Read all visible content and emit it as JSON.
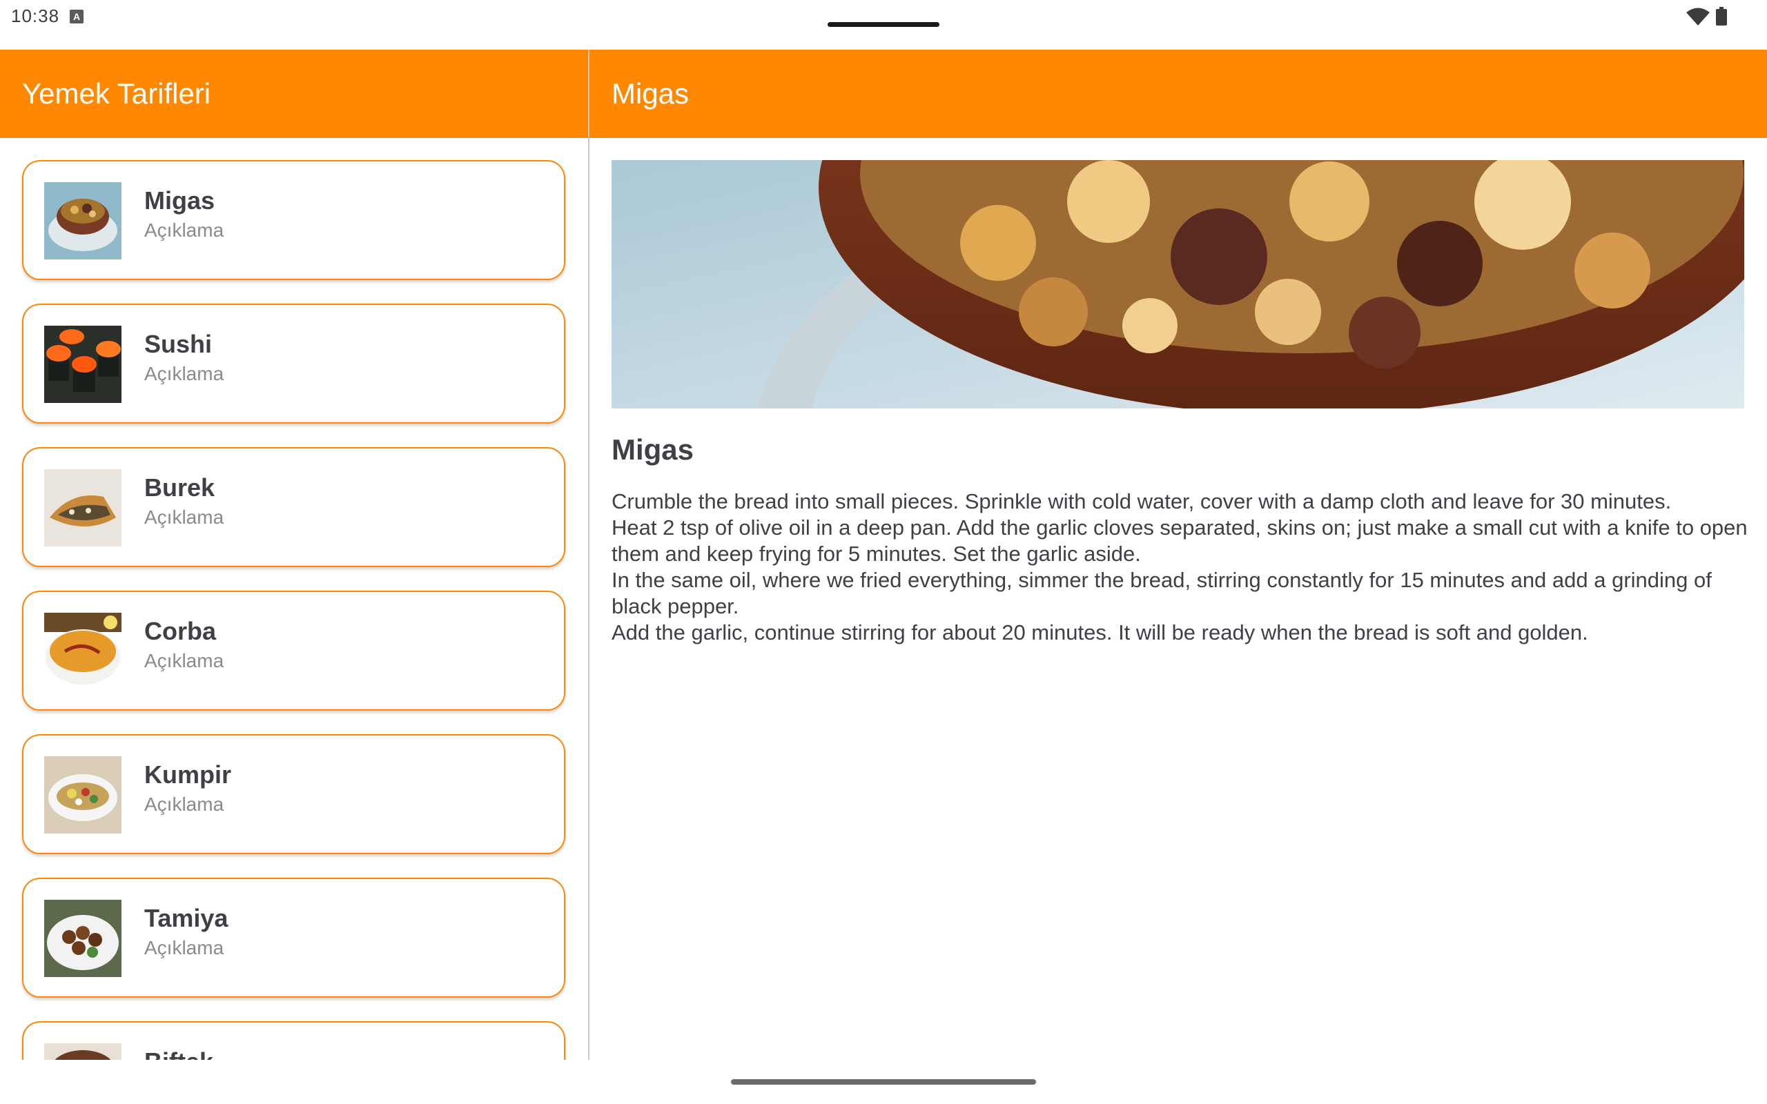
{
  "status_bar": {
    "time": "10:38",
    "indicator": "A",
    "icons": [
      "wifi-icon",
      "battery-icon"
    ]
  },
  "list_header": {
    "title": "Yemek Tarifleri"
  },
  "recipes": [
    {
      "title": "Migas",
      "subtitle": "Açıklama",
      "thumbnail": "migas-thumbnail"
    },
    {
      "title": "Sushi",
      "subtitle": "Açıklama",
      "thumbnail": "sushi-thumbnail"
    },
    {
      "title": "Burek",
      "subtitle": "Açıklama",
      "thumbnail": "burek-thumbnail"
    },
    {
      "title": "Corba",
      "subtitle": "Açıklama",
      "thumbnail": "corba-thumbnail"
    },
    {
      "title": "Kumpir",
      "subtitle": "Açıklama",
      "thumbnail": "kumpir-thumbnail"
    },
    {
      "title": "Tamiya",
      "subtitle": "Açıklama",
      "thumbnail": "tamiya-thumbnail"
    },
    {
      "title": "Biftek",
      "subtitle": "",
      "thumbnail": "biftek-thumbnail"
    }
  ],
  "detail": {
    "header_title": "Migas",
    "title": "Migas",
    "description": "Crumble the bread into small pieces. Sprinkle with cold water, cover with a damp cloth and leave for 30 minutes.\nHeat 2 tsp of olive oil in a deep pan. Add the garlic cloves separated, skins on; just make a small cut with a knife to open them and keep frying for 5 minutes. Set the garlic aside.\nIn the same oil, where we fried everything, simmer the bread, stirring constantly for 15 minutes and add a grinding of black pepper.\nAdd the garlic, continue stirring for about 20 minutes. It will be ready when the bread is soft and golden."
  },
  "colors": {
    "accent": "#ff8800",
    "text_dark": "#3f3f46",
    "text_muted": "#8a8a8a"
  }
}
